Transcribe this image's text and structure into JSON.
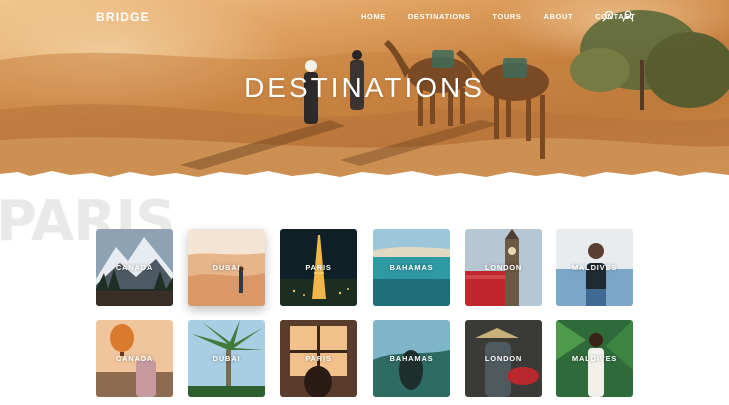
{
  "brand": {
    "logo": "BRIDGE"
  },
  "nav": {
    "items": [
      {
        "label": "HOME"
      },
      {
        "label": "DESTINATIONS"
      },
      {
        "label": "TOURS"
      },
      {
        "label": "ABOUT"
      },
      {
        "label": "CONTACT"
      }
    ],
    "icons": [
      "search-icon",
      "user-icon"
    ]
  },
  "hero": {
    "title": "DESTINATIONS"
  },
  "background_word": "PARIS",
  "destinations": {
    "row1": [
      {
        "label": "CANADA"
      },
      {
        "label": "DUBAI"
      },
      {
        "label": "PARIS"
      },
      {
        "label": "BAHAMAS"
      },
      {
        "label": "LONDON"
      },
      {
        "label": "MALDIVES"
      }
    ],
    "row2": [
      {
        "label": "CANADA"
      },
      {
        "label": "DUBAI"
      },
      {
        "label": "PARIS"
      },
      {
        "label": "BAHAMAS"
      },
      {
        "label": "LONDON"
      },
      {
        "label": "MALDIVES"
      }
    ]
  },
  "colors": {
    "sand": "#d89a58",
    "white": "#ffffff",
    "background_word": "#e9e9e9"
  }
}
